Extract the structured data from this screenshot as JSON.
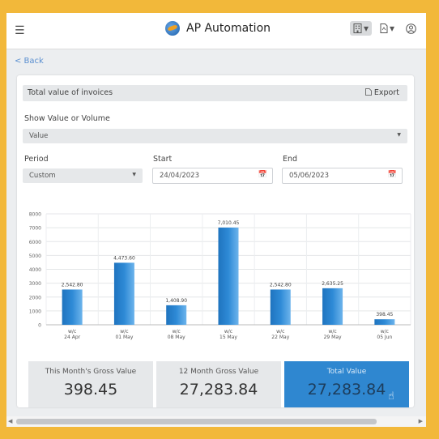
{
  "app": {
    "title": "AP Automation",
    "menu_icon": "hamburger-icon",
    "logo_icon": "globe-logo-icon",
    "tools": [
      {
        "icon": "building-icon",
        "caret": "▾"
      },
      {
        "icon": "pdf-document-icon",
        "caret": "▾"
      },
      {
        "icon": "user-circle-icon"
      }
    ]
  },
  "nav": {
    "back_label": "< Back"
  },
  "card": {
    "title": "Total value of invoices",
    "export_label": "Export",
    "value_volume": {
      "label": "Show Value or Volume",
      "selected": "Value"
    },
    "period": {
      "label": "Period",
      "selected": "Custom"
    },
    "start": {
      "label": "Start",
      "value": "24/04/2023"
    },
    "end": {
      "label": "End",
      "value": "05/06/2023"
    }
  },
  "chart_data": {
    "type": "bar",
    "categories": [
      "w/c 24 Apr",
      "w/c 01 May",
      "w/c 08 May",
      "w/c 15 May",
      "w/c 22 May",
      "w/c 29 May",
      "w/c 05 Jun"
    ],
    "tick_lines": [
      [
        "w/c",
        "24 Apr"
      ],
      [
        "w/c",
        "01 May"
      ],
      [
        "w/c",
        "08 May"
      ],
      [
        "w/c",
        "15 May"
      ],
      [
        "w/c",
        "22 May"
      ],
      [
        "w/c",
        "29 May"
      ],
      [
        "w/c",
        "05 Jun"
      ]
    ],
    "values": [
      2542.8,
      4473.6,
      1408.9,
      7010.45,
      2542.8,
      2635.25,
      398.45
    ],
    "labels": [
      "2,542.80",
      "4,473.60",
      "1,408.90",
      "7,010.45",
      "2,542.80",
      "2,635.25",
      "398.45"
    ],
    "ylim": [
      0,
      8000
    ],
    "yticks": [
      0,
      1000,
      2000,
      3000,
      4000,
      5000,
      6000,
      7000,
      8000
    ],
    "grid": true,
    "bar_color": "#2e8ad6"
  },
  "tiles": [
    {
      "label": "This Month's Gross Value",
      "value": "398.45"
    },
    {
      "label": "12 Month Gross Value",
      "value": "27,283.84"
    },
    {
      "label": "Total Value",
      "value": "27,283.84"
    }
  ],
  "colors": {
    "frame": "#f2b83a",
    "accent": "#2f87d0"
  }
}
